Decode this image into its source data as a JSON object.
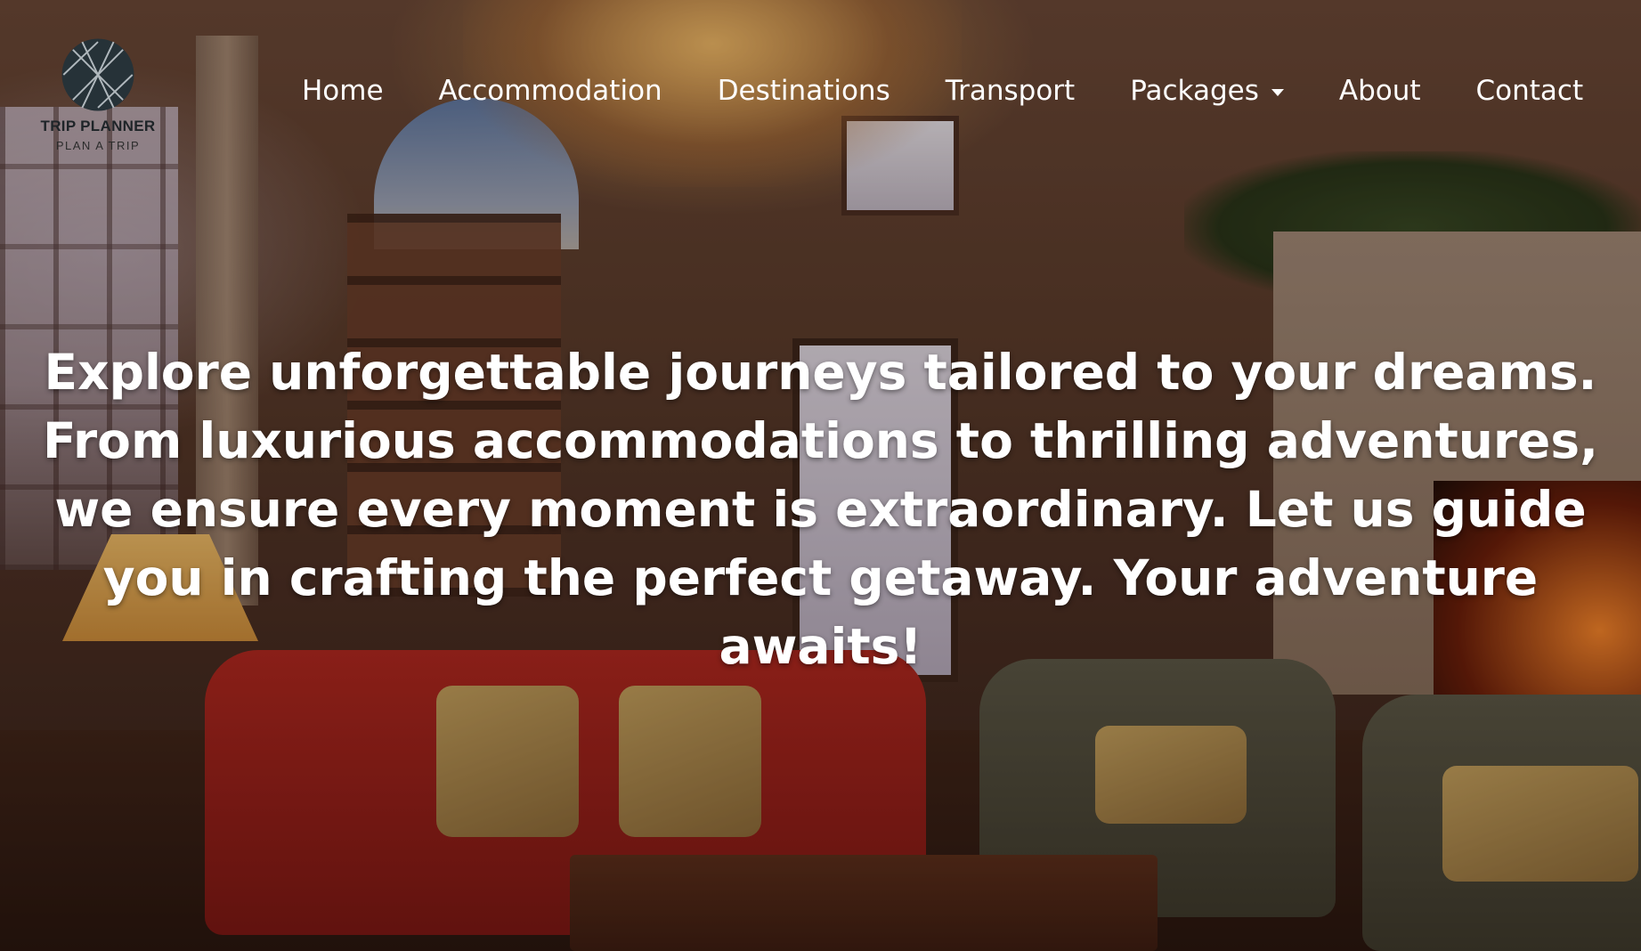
{
  "brand": {
    "name": "TRIP PLANNER",
    "tagline": "PLAN A TRIP",
    "logo_icon": "geometric-globe-icon"
  },
  "nav": {
    "items": [
      {
        "label": "Home"
      },
      {
        "label": "Accommodation"
      },
      {
        "label": "Destinations"
      },
      {
        "label": "Transport"
      },
      {
        "label": "Packages",
        "has_dropdown": true
      },
      {
        "label": "About"
      },
      {
        "label": "Contact"
      }
    ]
  },
  "hero": {
    "headline": "Explore unforgettable journeys tailored to your dreams. From luxurious accommodations to thrilling adventures, we ensure every moment is extraordinary. Let us guide you in crafting the perfect getaway. Your adventure awaits!"
  },
  "colors": {
    "nav_text": "#ffffff",
    "headline_text": "#ffffff",
    "logo_text": "#1e2428"
  }
}
